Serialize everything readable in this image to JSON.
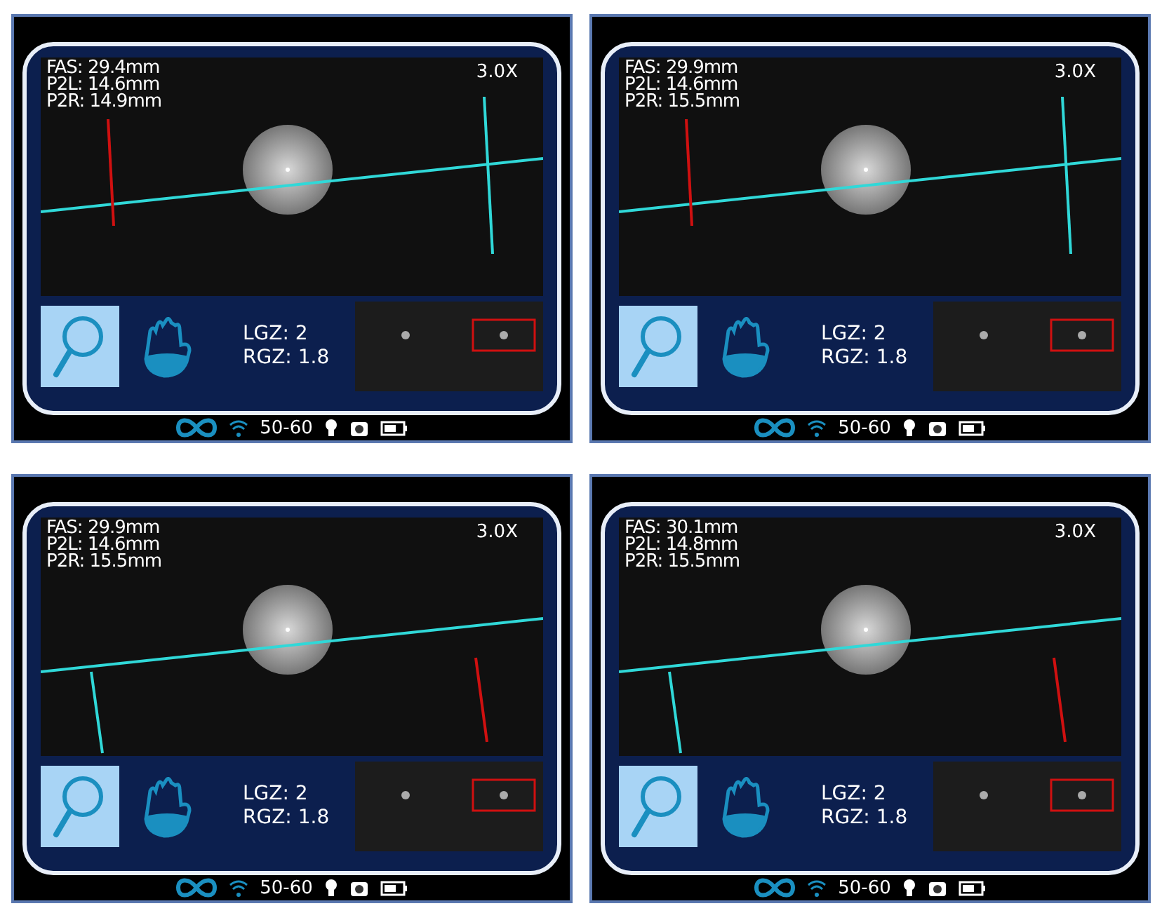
{
  "panels": [
    {
      "measurements": [
        "FAS: 29.4mm",
        "P2L: 14.6mm",
        "P2R: 14.9mm"
      ],
      "zoom": "3.0X",
      "markers": [
        {
          "selected": true
        },
        {
          "selected": false
        }
      ],
      "tools": [
        {
          "kind": "magnifier",
          "selected": true
        },
        {
          "kind": "hand",
          "selected": false
        }
      ],
      "gaze": [
        "LGZ: 2",
        "RGZ: 1.8"
      ],
      "status": "50-60"
    },
    {
      "measurements": [
        "FAS: 29.9mm",
        "P2L: 14.6mm",
        "P2R: 15.5mm"
      ],
      "zoom": "3.0X",
      "markers": [
        {
          "selected": true
        },
        {
          "selected": false
        }
      ],
      "tools": [
        {
          "kind": "magnifier",
          "selected": true
        },
        {
          "kind": "hand",
          "selected": false
        }
      ],
      "gaze": [
        "LGZ: 2",
        "RGZ: 1.8"
      ],
      "status": "50-60"
    },
    {
      "measurements": [
        "FAS: 29.9mm",
        "P2L: 14.6mm",
        "P2R: 15.5mm"
      ],
      "zoom": "3.0X",
      "markers": [
        {
          "selected": false
        },
        {
          "selected": true
        }
      ],
      "tools": [
        {
          "kind": "magnifier",
          "selected": true
        },
        {
          "kind": "hand",
          "selected": false
        }
      ],
      "gaze": [
        "LGZ: 2",
        "RGZ: 1.8"
      ],
      "status": "50-60"
    },
    {
      "measurements": [
        "FAS: 30.1mm",
        "P2L: 14.8mm",
        "P2R: 15.5mm"
      ],
      "zoom": "3.0X",
      "markers": [
        {
          "selected": false
        },
        {
          "selected": true
        }
      ],
      "tools": [
        {
          "kind": "magnifier",
          "selected": true
        },
        {
          "kind": "hand",
          "selected": false
        }
      ],
      "gaze": [
        "LGZ: 2",
        "RGZ: 1.8"
      ],
      "status": "50-60"
    }
  ]
}
